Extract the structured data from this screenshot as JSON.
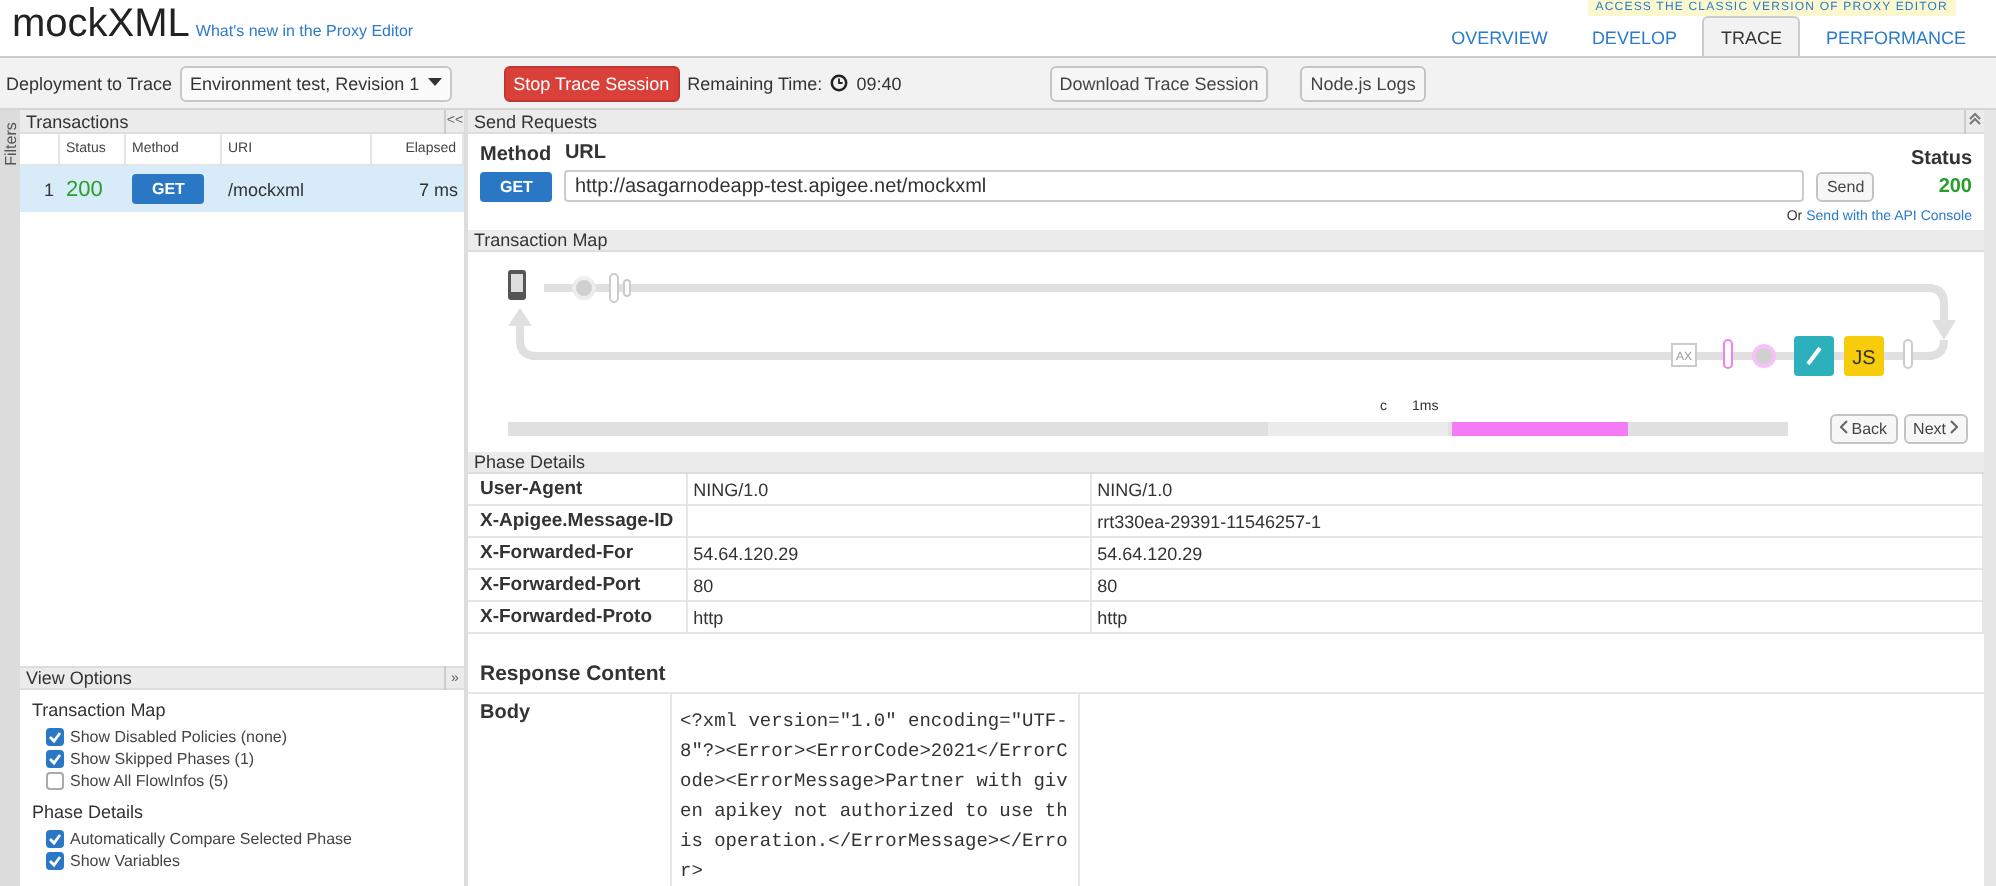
{
  "header": {
    "title": "mockXML",
    "whats_new_link": "What's new in the Proxy Editor",
    "classic_banner": "ACCESS THE CLASSIC VERSION OF PROXY EDITOR",
    "tabs": [
      {
        "label": "OVERVIEW",
        "selected": false
      },
      {
        "label": "DEVELOP",
        "selected": false
      },
      {
        "label": "TRACE",
        "selected": true
      },
      {
        "label": "PERFORMANCE",
        "selected": false
      }
    ]
  },
  "toolbar": {
    "deployment_label": "Deployment to Trace",
    "deployment_value": "Environment test, Revision 1",
    "stop_button": "Stop Trace Session",
    "remaining_label": "Remaining Time:",
    "remaining_time": "09:40",
    "download_button": "Download Trace Session",
    "logs_button": "Node.js Logs"
  },
  "filters_tab": "Filters",
  "transactions": {
    "title": "Transactions",
    "collapse": "<<",
    "columns": [
      "Status",
      "Method",
      "URI",
      "Elapsed"
    ],
    "rows": [
      {
        "index": "1",
        "status": "200",
        "method": "GET",
        "uri": "/mockxml",
        "elapsed": "7 ms",
        "selected": true
      }
    ]
  },
  "view_options": {
    "title": "View Options",
    "collapse": "»",
    "groups": [
      {
        "title": "Transaction Map",
        "options": [
          {
            "label": "Show Disabled Policies (none)",
            "checked": true
          },
          {
            "label": "Show Skipped Phases (1)",
            "checked": true
          },
          {
            "label": "Show All FlowInfos (5)",
            "checked": false
          }
        ]
      },
      {
        "title": "Phase Details",
        "options": [
          {
            "label": "Automatically Compare Selected Phase",
            "checked": true
          },
          {
            "label": "Show Variables",
            "checked": true
          }
        ]
      }
    ]
  },
  "send_requests": {
    "title": "Send Requests",
    "method_label": "Method",
    "url_label": "URL",
    "method": "GET",
    "url": "http://asagarnodeapp-test.apigee.net/mockxml",
    "send_button": "Send",
    "status_label": "Status",
    "status": "200",
    "console_prefix": "Or",
    "console_link": "Send with the API Console"
  },
  "transaction_map": {
    "title": "Transaction Map",
    "nodes": [
      {
        "kind": "step",
        "label": "AX"
      },
      {
        "kind": "bar"
      },
      {
        "kind": "dot"
      },
      {
        "kind": "edit"
      },
      {
        "kind": "js",
        "label": "JS"
      },
      {
        "kind": "end"
      }
    ],
    "timeline_labels": [
      "c",
      "1ms"
    ],
    "back_button": "Back",
    "next_button": "Next"
  },
  "phase_details": {
    "title": "Phase Details",
    "rows": [
      {
        "name": "User-Agent",
        "before": "NING/1.0",
        "after": "NING/1.0"
      },
      {
        "name": "X-Apigee.Message-ID",
        "before": "",
        "after": "rrt330ea-29391-11546257-1"
      },
      {
        "name": "X-Forwarded-For",
        "before": "54.64.120.29",
        "after": "54.64.120.29"
      },
      {
        "name": "X-Forwarded-Port",
        "before": "80",
        "after": "80"
      },
      {
        "name": "X-Forwarded-Proto",
        "before": "http",
        "after": "http"
      }
    ]
  },
  "response_content": {
    "title": "Response Content",
    "body_label": "Body",
    "body": "<?xml version=\"1.0\" encoding=\"UTF-8\"?><Error><ErrorCode>2021</ErrorCode><ErrorMessage>Partner with given apikey not authorized to use this operation.</ErrorMessage></Error>"
  }
}
